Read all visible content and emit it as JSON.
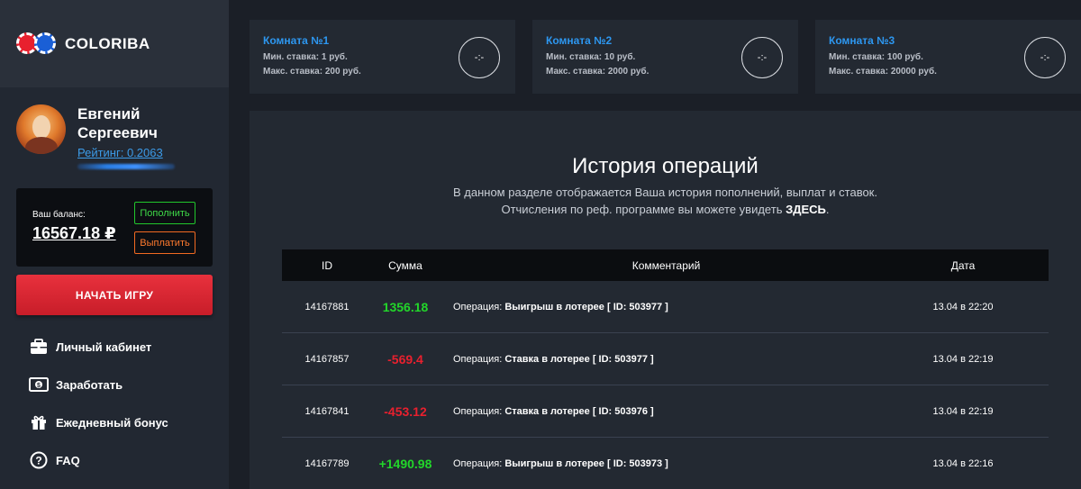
{
  "brand": {
    "name": "COLORIBA"
  },
  "user": {
    "first_name": "Евгений",
    "last_name": "Сергеевич",
    "rating": "Рейтинг: 0.2063"
  },
  "balance": {
    "label": "Ваш баланс:",
    "value": "16567.18 ₽",
    "deposit_label": "Пополнить",
    "withdraw_label": "Выплатить"
  },
  "play_label": "НАЧАТЬ ИГРУ",
  "nav": [
    {
      "label": "Личный кабинет",
      "icon": "briefcase-icon"
    },
    {
      "label": "Заработать",
      "icon": "money-icon"
    },
    {
      "label": "Ежедневный бонус",
      "icon": "gift-icon"
    },
    {
      "label": "FAQ",
      "icon": "question-icon"
    }
  ],
  "rooms": [
    {
      "title": "Комната №1",
      "min": "Мин. ставка: 1 руб.",
      "max": "Макс. ставка: 200 руб.",
      "timer": "-:-"
    },
    {
      "title": "Комната №2",
      "min": "Мин. ставка: 10 руб.",
      "max": "Макс. ставка: 2000 руб.",
      "timer": "-:-"
    },
    {
      "title": "Комната №3",
      "min": "Мин. ставка: 100 руб.",
      "max": "Макс. ставка: 20000 руб.",
      "timer": "-:-"
    }
  ],
  "history": {
    "title": "История операций",
    "desc_line1": "В данном разделе отображается Ваша история пополнений, выплат и ставок.",
    "desc_line2": "Отчисления по реф. программе вы можете увидеть ",
    "desc_link": "ЗДЕСЬ",
    "desc_end": ".",
    "columns": [
      "ID",
      "Сумма",
      "Комментарий",
      "Дата"
    ],
    "rows": [
      {
        "id": "14167881",
        "sum": "1356.18",
        "op": "Операция:",
        "detail": "Выигрыш в лотерее [ ID: 503977 ]",
        "date": "13.04 в 22:20"
      },
      {
        "id": "14167857",
        "sum": "-569.4",
        "op": "Операция:",
        "detail": "Ставка в лотерее [ ID: 503977 ]",
        "date": "13.04 в 22:19"
      },
      {
        "id": "14167841",
        "sum": "-453.12",
        "op": "Операция:",
        "detail": "Ставка в лотерее [ ID: 503976 ]",
        "date": "13.04 в 22:19"
      },
      {
        "id": "14167789",
        "sum": "+1490.98",
        "op": "Операция:",
        "detail": "Выигрыш в лотерее [ ID: 503973 ]",
        "date": "13.04 в 22:16"
      }
    ]
  },
  "colors": {
    "accent_blue": "#2d97f0",
    "positive": "#22d62a",
    "negative": "#e8202e",
    "play_button": "#d9252f"
  }
}
